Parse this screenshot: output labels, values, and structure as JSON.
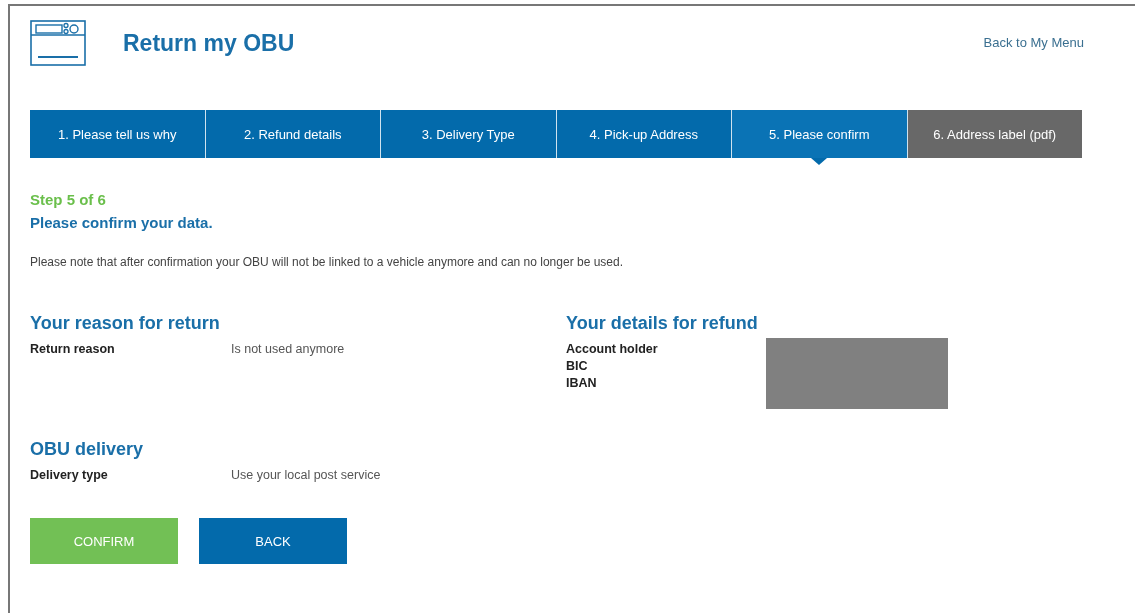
{
  "header": {
    "title": "Return my OBU",
    "back_link": "Back to My Menu"
  },
  "steps": [
    {
      "label": "1. Please tell us why",
      "selected": false,
      "disabled": false
    },
    {
      "label": "2. Refund details",
      "selected": false,
      "disabled": false
    },
    {
      "label": "3. Delivery Type",
      "selected": false,
      "disabled": false
    },
    {
      "label": "4. Pick-up Address",
      "selected": false,
      "disabled": false
    },
    {
      "label": "5. Please confirm",
      "selected": true,
      "disabled": false
    },
    {
      "label": "6. Address label (pdf)",
      "selected": false,
      "disabled": true
    }
  ],
  "step_counter": "Step 5 of 6",
  "heading": "Please confirm your data.",
  "note": "Please note that after confirmation your OBU will not be linked to a vehicle anymore and can no longer be used.",
  "reason_section": {
    "title": "Your reason for return",
    "rows": [
      {
        "label": "Return reason",
        "value": "Is not used anymore"
      }
    ]
  },
  "refund_section": {
    "title": "Your details for refund",
    "labels": [
      "Account holder",
      "BIC",
      "IBAN"
    ]
  },
  "delivery_section": {
    "title": "OBU delivery",
    "rows": [
      {
        "label": "Delivery type",
        "value": "Use your local post service"
      }
    ]
  },
  "buttons": [
    {
      "label": "CONFIRM",
      "kind": "primary"
    },
    {
      "label": "BACK",
      "kind": "secondary"
    }
  ]
}
